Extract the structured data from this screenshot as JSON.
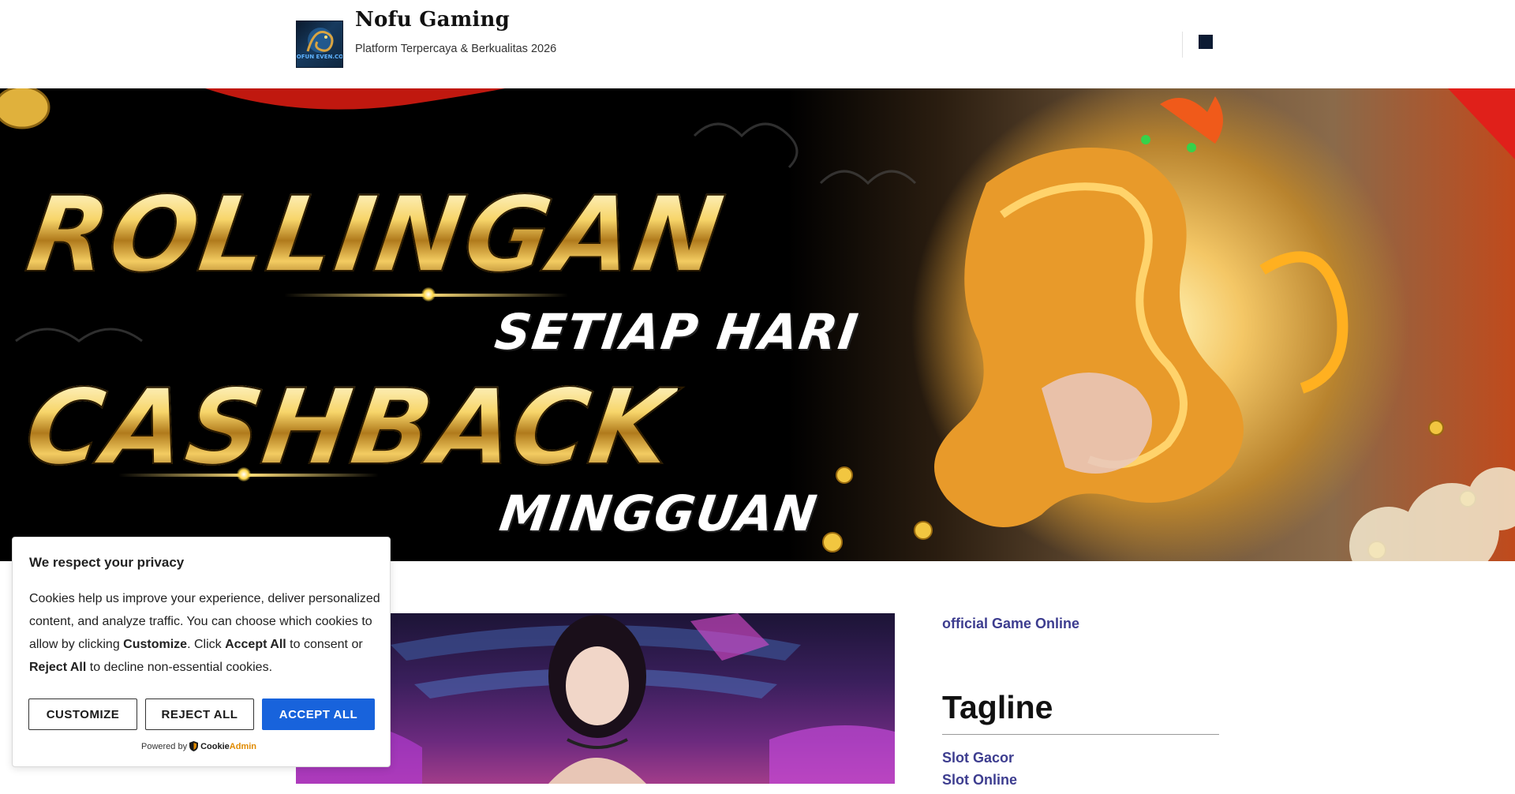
{
  "header": {
    "site_title": "Nofu Gaming",
    "tagline": "Platform Terpercaya & Berkualitas 2026",
    "logo_text": "NOFUN EVEN.COM"
  },
  "hero": {
    "line1": "ROLLINGAN",
    "line2": "SETIAP HARI",
    "line3": "CASHBACK",
    "line4": "MINGGUAN"
  },
  "sidebar": {
    "official_link": "official Game Online",
    "heading": "Tagline",
    "links": [
      "Slot Gacor",
      "Slot Online"
    ]
  },
  "cookie": {
    "title": "We respect your privacy",
    "body_1": "Cookies help us improve your experience, deliver personalized content, and analyze traffic. You can choose which cookies to allow by clicking ",
    "body_customize": "Customize",
    "body_2": ". Click ",
    "body_accept": "Accept All",
    "body_3": " to consent or ",
    "body_reject": "Reject All",
    "body_4": " to decline non-essential cookies.",
    "btn_customize": "CUSTOMIZE",
    "btn_reject": "REJECT ALL",
    "btn_accept": "ACCEPT ALL",
    "powered_by": "Powered by",
    "brand_cookie": "Cookie",
    "brand_admin": "Admin"
  },
  "colors": {
    "accent_link": "#3d3d8f",
    "accept_button": "#1863dc",
    "menu_icon": "#0c1b33"
  },
  "icons": {
    "menu": "menu-square-icon",
    "cookieadmin": "shield-icon"
  }
}
